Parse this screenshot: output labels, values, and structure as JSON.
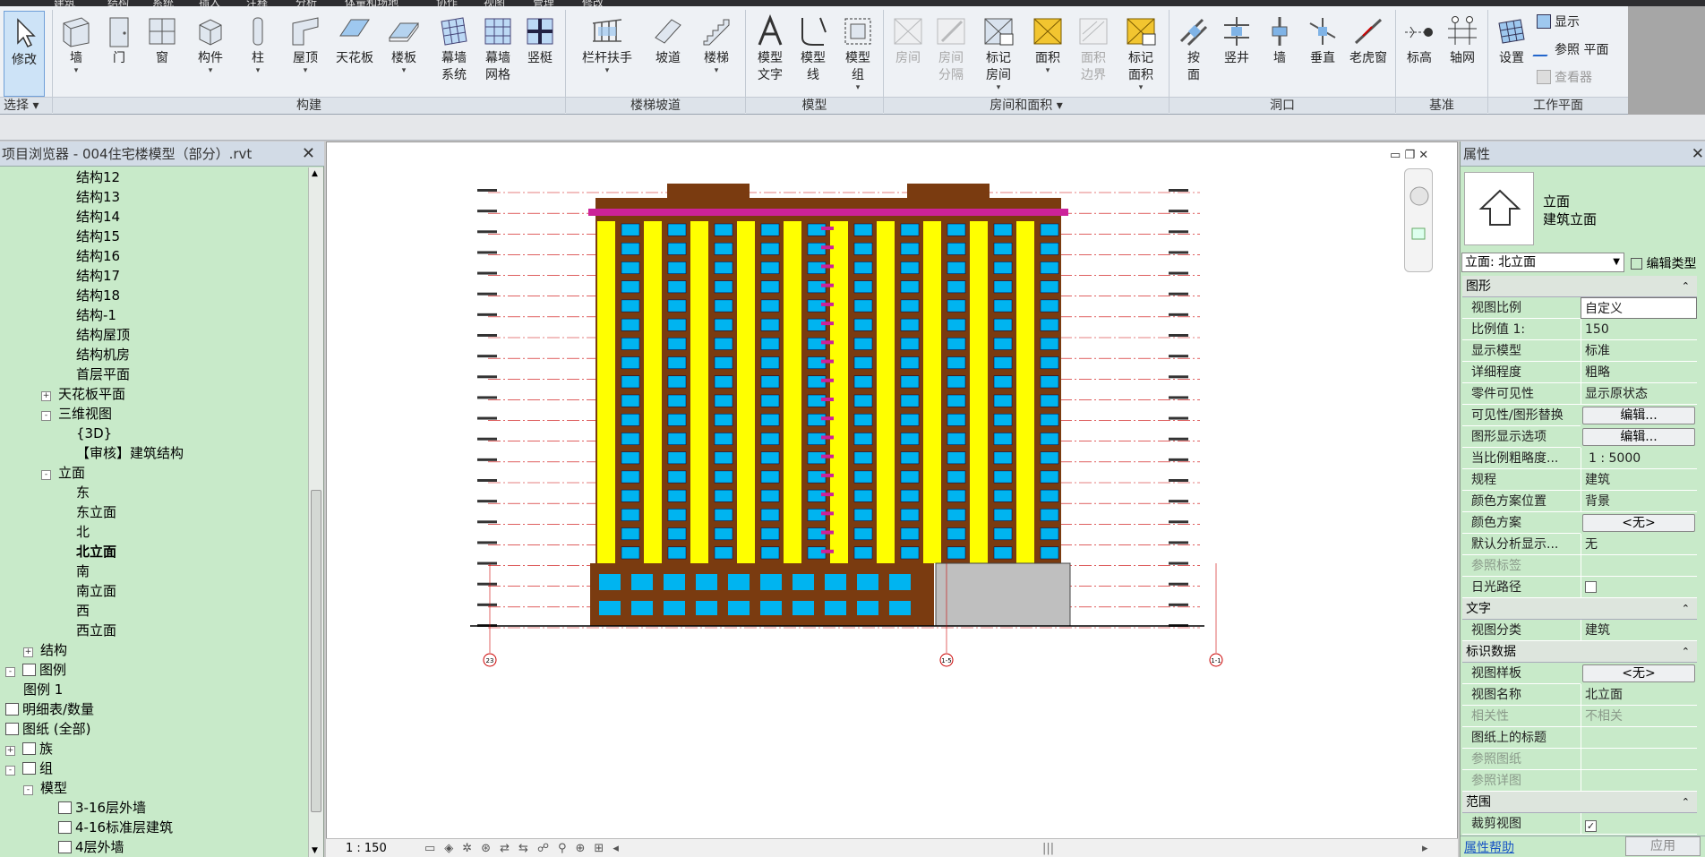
{
  "menu": {
    "items": [
      "建筑",
      "结构",
      "系统",
      "插入",
      "注释",
      "分析",
      "体量和场地",
      "协作",
      "视图",
      "管理",
      "修改"
    ]
  },
  "ribbon": {
    "modify_label": "修改",
    "select_label": "选择",
    "build": {
      "panel_label": "构建",
      "buttons": [
        "墙",
        "门",
        "窗",
        "构件",
        "柱",
        "屋顶",
        "天花板",
        "楼板"
      ],
      "curtain_system": [
        "幕墙",
        "系统"
      ],
      "curtain_grid": [
        "幕墙",
        "网格"
      ],
      "mullion": "竖梃"
    },
    "circulation": {
      "panel_label": "楼梯坡道",
      "railing": "栏杆扶手",
      "ramp": "坡道",
      "stair": "楼梯"
    },
    "model": {
      "panel_label": "模型",
      "model_text": [
        "模型",
        "文字"
      ],
      "model_line": [
        "模型",
        "线"
      ],
      "model_group": [
        "模型",
        "组"
      ]
    },
    "room": {
      "panel_label": "房间和面积",
      "room": "房间",
      "room_sep": [
        "房间",
        "分隔"
      ],
      "tag_room": [
        "标记",
        "房间"
      ],
      "area": "面积",
      "area_boundary": [
        "面积",
        "边界"
      ],
      "tag_area": [
        "标记",
        "面积"
      ]
    },
    "opening": {
      "panel_label": "洞口",
      "by_face": [
        "按",
        "面"
      ],
      "shaft": "竖井",
      "wall": "墙",
      "vertical": "垂直",
      "dormer": "老虎窗"
    },
    "datum": {
      "panel_label": "基准",
      "level": "标高",
      "grid": "轴网"
    },
    "workplane": {
      "panel_label": "工作平面",
      "set": "设置",
      "show": "显示",
      "ref_plane": "参照 平面",
      "viewer": "查看器"
    }
  },
  "browser": {
    "title": "项目浏览器 - 004住宅楼模型（部分）.rvt",
    "items": [
      {
        "label": "结构12",
        "level": 3,
        "toggle": ""
      },
      {
        "label": "结构13",
        "level": 3,
        "toggle": ""
      },
      {
        "label": "结构14",
        "level": 3,
        "toggle": ""
      },
      {
        "label": "结构15",
        "level": 3,
        "toggle": ""
      },
      {
        "label": "结构16",
        "level": 3,
        "toggle": ""
      },
      {
        "label": "结构17",
        "level": 3,
        "toggle": ""
      },
      {
        "label": "结构18",
        "level": 3,
        "toggle": ""
      },
      {
        "label": "结构-1",
        "level": 3,
        "toggle": ""
      },
      {
        "label": "结构屋顶",
        "level": 3,
        "toggle": ""
      },
      {
        "label": "结构机房",
        "level": 3,
        "toggle": ""
      },
      {
        "label": "首层平面",
        "level": 3,
        "toggle": ""
      },
      {
        "label": "天花板平面",
        "level": 2,
        "toggle": "+"
      },
      {
        "label": "三维视图",
        "level": 2,
        "toggle": "-"
      },
      {
        "label": "{3D}",
        "level": 3,
        "toggle": ""
      },
      {
        "label": "【审核】建筑结构",
        "level": 3,
        "toggle": ""
      },
      {
        "label": "立面",
        "level": 2,
        "toggle": "-"
      },
      {
        "label": "东",
        "level": 3,
        "toggle": ""
      },
      {
        "label": "东立面",
        "level": 3,
        "toggle": ""
      },
      {
        "label": "北",
        "level": 3,
        "toggle": ""
      },
      {
        "label": "北立面",
        "level": 3,
        "toggle": "",
        "bold": true
      },
      {
        "label": "南",
        "level": 3,
        "toggle": ""
      },
      {
        "label": "南立面",
        "level": 3,
        "toggle": ""
      },
      {
        "label": "西",
        "level": 3,
        "toggle": ""
      },
      {
        "label": "西立面",
        "level": 3,
        "toggle": ""
      },
      {
        "label": "结构",
        "level": 1,
        "toggle": "+"
      },
      {
        "label": "图例",
        "level": 0,
        "toggle": "-",
        "icon": true
      },
      {
        "label": "图例 1",
        "level": 1,
        "toggle": ""
      },
      {
        "label": "明细表/数量",
        "level": 0,
        "toggle": "",
        "icon": true
      },
      {
        "label": "图纸 (全部)",
        "level": 0,
        "toggle": "",
        "icon": true
      },
      {
        "label": "族",
        "level": 0,
        "toggle": "+",
        "icon": true
      },
      {
        "label": "组",
        "level": 0,
        "toggle": "-",
        "icon": true
      },
      {
        "label": "模型",
        "level": 1,
        "toggle": "-"
      },
      {
        "label": "3-16层外墙",
        "level": 2,
        "toggle": "",
        "icon": true
      },
      {
        "label": "4-16标准层建筑",
        "level": 2,
        "toggle": "",
        "icon": true
      },
      {
        "label": "4层外墙",
        "level": 2,
        "toggle": "",
        "icon": true
      }
    ]
  },
  "view": {
    "scale_label": "1 : 150",
    "grid_bubbles": [
      "23",
      "1-5",
      "1-1"
    ],
    "building_colors": {
      "wall": "#ffff00",
      "frame": "#7a3b10",
      "glass": "#00b4f0",
      "rail": "#cc2299",
      "podium": "#bfbfbf"
    },
    "floors": 18
  },
  "props": {
    "title": "属性",
    "type_line1": "立面",
    "type_line2": "建筑立面",
    "selector": "立面: 北立面",
    "edit_type": "编辑类型",
    "groups": {
      "graphics": "图形",
      "text": "文字",
      "identity": "标识数据",
      "extents": "范围"
    },
    "rows": {
      "view_scale": {
        "label": "视图比例",
        "value": "自定义"
      },
      "scale_value": {
        "label": "比例值 1:",
        "value": "150"
      },
      "display_model": {
        "label": "显示模型",
        "value": "标准"
      },
      "detail_level": {
        "label": "详细程度",
        "value": "粗略"
      },
      "parts_vis": {
        "label": "零件可见性",
        "value": "显示原状态"
      },
      "vg_override": {
        "label": "可见性/图形替换",
        "value": "编辑..."
      },
      "graphic_display": {
        "label": "图形显示选项",
        "value": "编辑..."
      },
      "coarse_scale": {
        "label": "当比例粗略度...",
        "value": "1 : 5000"
      },
      "discipline": {
        "label": "规程",
        "value": "建筑"
      },
      "color_scheme_loc": {
        "label": "颜色方案位置",
        "value": "背景"
      },
      "color_scheme": {
        "label": "颜色方案",
        "value": "<无>"
      },
      "default_analysis": {
        "label": "默认分析显示...",
        "value": "无"
      },
      "ref_label": {
        "label": "参照标签",
        "value": ""
      },
      "sun_path": {
        "label": "日光路径",
        "value": ""
      },
      "view_category": {
        "label": "视图分类",
        "value": "建筑"
      },
      "view_template": {
        "label": "视图样板",
        "value": "<无>"
      },
      "view_name": {
        "label": "视图名称",
        "value": "北立面"
      },
      "dependency": {
        "label": "相关性",
        "value": "不相关"
      },
      "title_on_sheet": {
        "label": "图纸上的标题",
        "value": ""
      },
      "ref_sheet": {
        "label": "参照图纸",
        "value": ""
      },
      "ref_detail": {
        "label": "参照详图",
        "value": ""
      },
      "crop_view": {
        "label": "裁剪视图",
        "value": "✓"
      }
    },
    "help": "属性帮助",
    "apply": "应用"
  }
}
